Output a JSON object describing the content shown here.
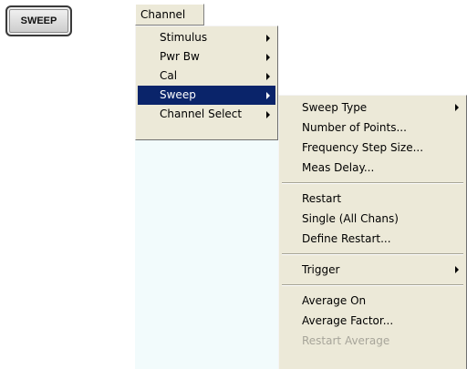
{
  "hardkey": {
    "label": "SWEEP",
    "icon": "sweep-hardkey"
  },
  "menubar": {
    "channel_label": "Channel"
  },
  "channel_menu": {
    "items": [
      {
        "label": "Stimulus",
        "submenu": true
      },
      {
        "label": "Pwr Bw",
        "submenu": true
      },
      {
        "label": "Cal",
        "submenu": true
      },
      {
        "label": "Sweep",
        "submenu": true,
        "selected": true
      },
      {
        "label": "Channel Select",
        "submenu": true
      }
    ]
  },
  "sweep_menu": {
    "items": [
      {
        "label": "Sweep Type",
        "submenu": true
      },
      {
        "label": "Number of Points..."
      },
      {
        "label": "Frequency Step Size..."
      },
      {
        "label": "Meas Delay..."
      },
      {
        "label": "Restart"
      },
      {
        "label": "Single (All Chans)"
      },
      {
        "label": "Define Restart..."
      },
      {
        "label": "Trigger",
        "submenu": true
      },
      {
        "label": "Average On"
      },
      {
        "label": "Average Factor..."
      },
      {
        "label": "Restart Average",
        "disabled": true
      }
    ]
  },
  "colors": {
    "menu_bg": "#ece9d8",
    "highlight": "#0a246a",
    "disabled_text": "#a7a59a"
  }
}
